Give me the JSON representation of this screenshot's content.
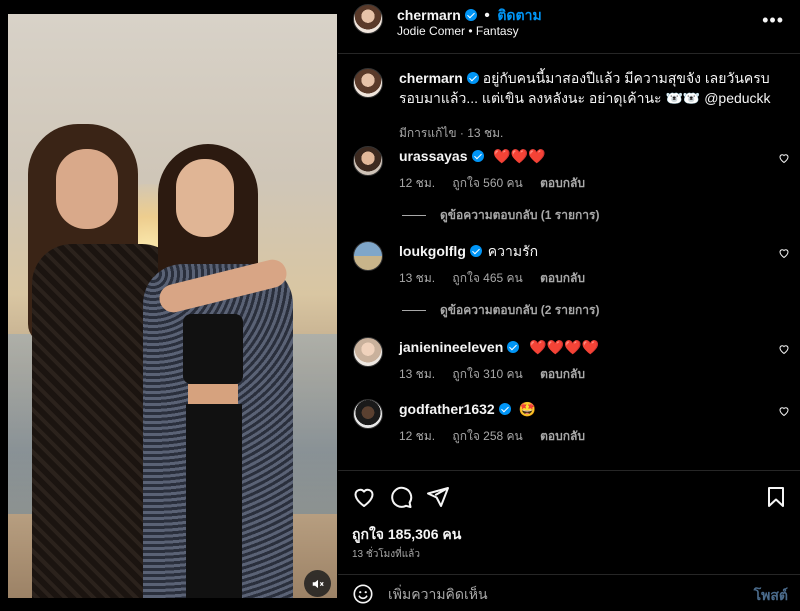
{
  "post": {
    "author": "chermarn",
    "follow_label": "ติดตาม",
    "separator": "•",
    "subtitle": "Jodie Comer • Fantasy",
    "more": "•••"
  },
  "caption": {
    "username": "chermarn",
    "text": "อยู่กับคนนี้มาสองปีแล้ว มีความสุขจัง เลยวันครบรอบมาแล้ว... แต่เขิน ลงหลังนะ อย่าดุเค้านะ 🐻‍❄️🐻‍❄️ @peduckk",
    "meta": "มีการแก้ไข · 13 ชม."
  },
  "comments": [
    {
      "username": "urassayas",
      "text": "❤️❤️❤️",
      "time": "12 ชม.",
      "likes": "ถูกใจ 560 คน",
      "reply": "ตอบกลับ",
      "view_replies": "ดูข้อความตอบกลับ (1 รายการ)"
    },
    {
      "username": "loukgolflg",
      "text": "ความรัก",
      "time": "13 ชม.",
      "likes": "ถูกใจ 465 คน",
      "reply": "ตอบกลับ",
      "view_replies": "ดูข้อความตอบกลับ (2 รายการ)"
    },
    {
      "username": "janienineeleven",
      "text": "❤️❤️❤️❤️",
      "time": "13 ชม.",
      "likes": "ถูกใจ 310 คน",
      "reply": "ตอบกลับ"
    },
    {
      "username": "godfather1632",
      "text": "🤩",
      "time": "12 ชม.",
      "likes": "ถูกใจ 258 คน",
      "reply": "ตอบกลับ"
    }
  ],
  "stats": {
    "likes": "ถูกใจ 185,306 คน",
    "time": "13 ชั่วโมงที่แล้ว"
  },
  "composer": {
    "placeholder": "เพิ่มความคิดเห็น",
    "post_label": "โพสต์"
  },
  "icons": {
    "like": "heart-icon",
    "comment": "comment-icon",
    "share": "share-icon",
    "save": "bookmark-icon",
    "emoji": "emoji-icon",
    "mute": "speaker-muted-icon",
    "more": "more-icon"
  },
  "colors": {
    "accent": "#0095f6",
    "background": "#000000",
    "heart": "#ff3040"
  }
}
